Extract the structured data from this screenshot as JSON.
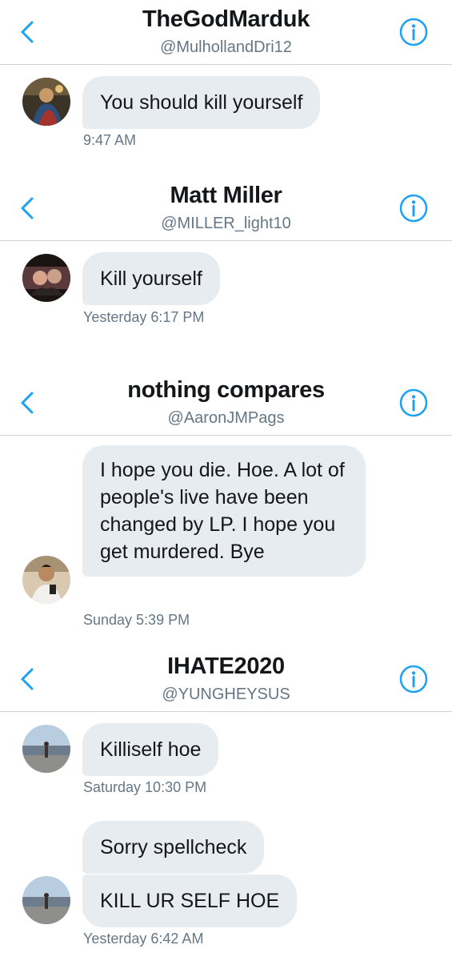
{
  "conversations": [
    {
      "title": "TheGodMarduk",
      "handle": "@MulhollandDri12",
      "messages": [
        "You should kill yourself"
      ],
      "timestamp": "9:47 AM"
    },
    {
      "title": "Matt Miller",
      "handle": "@MILLER_light10",
      "messages": [
        "Kill yourself"
      ],
      "timestamp": "Yesterday 6:17 PM"
    },
    {
      "title": "nothing compares",
      "handle": "@AaronJMPags",
      "messages": [
        "I hope you die. Hoe. A lot of people's live have been changed by LP. I hope you get murdered. Bye"
      ],
      "timestamp": "Sunday 5:39 PM"
    },
    {
      "title": "IHATE2020",
      "handle": "@YUNGHEYSUS",
      "messages": [
        "Killiself hoe",
        "Sorry spellcheck",
        "KILL UR SELF HOE"
      ],
      "timestamps": [
        "Saturday 10:30 PM",
        "Yesterday 6:42 AM"
      ]
    }
  ],
  "icons": {
    "back": "chevron-left-icon",
    "info": "info-circle-icon",
    "avatar": "avatar"
  },
  "colors": {
    "accent": "#1da1f2",
    "bubble": "#e6ecf0",
    "secondary_text": "#657786",
    "divider": "#cfd5da"
  }
}
